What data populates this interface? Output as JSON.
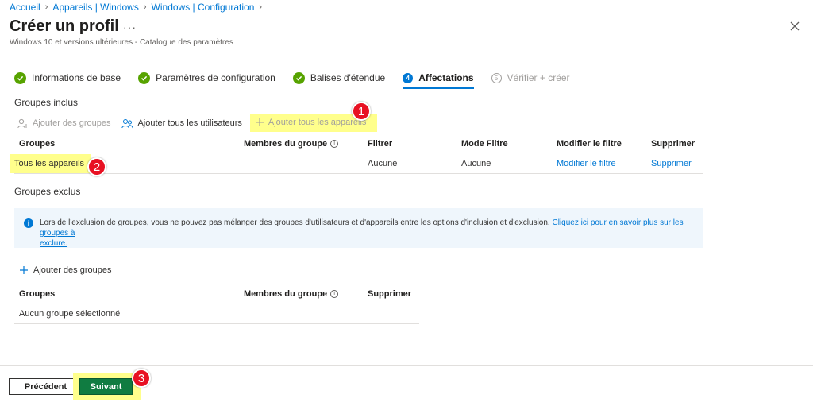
{
  "breadcrumb": [
    "Accueil",
    "Appareils | Windows",
    "Windows | Configuration"
  ],
  "header": {
    "title": "Créer un profil",
    "more": "···",
    "subtitle": "Windows 10 et versions ultérieures - Catalogue des paramètres"
  },
  "steps": [
    {
      "label": "Informations de base",
      "state": "done"
    },
    {
      "label": "Paramètres de configuration",
      "state": "done"
    },
    {
      "label": "Balises d'étendue",
      "state": "done"
    },
    {
      "label": "Affectations",
      "state": "active",
      "number": "4"
    },
    {
      "label": "Vérifier + créer",
      "state": "disabled",
      "number": "5"
    }
  ],
  "included": {
    "title": "Groupes inclus",
    "toolbar": {
      "add_groups": "Ajouter des groupes",
      "add_all_users": "Ajouter tous les utilisateurs",
      "add_all_devices": "Ajouter tous les appareils"
    },
    "columns": {
      "groups": "Groupes",
      "members": "Membres du groupe",
      "filter": "Filtrer",
      "filter_mode": "Mode Filtre",
      "edit_filter": "Modifier le filtre",
      "delete": "Supprimer"
    },
    "rows": [
      {
        "group": "Tous les appareils",
        "members": "",
        "filter": "Aucune",
        "filter_mode": "Aucune",
        "edit_filter": "Modifier le filtre",
        "delete": "Supprimer"
      }
    ]
  },
  "excluded": {
    "title": "Groupes exclus",
    "info_text": "Lors de l'exclusion de groupes, vous ne pouvez pas mélanger des groupes d'utilisateurs et d'appareils entre les options d'inclusion et d'exclusion. ",
    "info_link_part1": "Cliquez ici pour en savoir plus sur les groupes à",
    "info_link_part2": "exclure.",
    "add_groups": "Ajouter des groupes",
    "columns": {
      "groups": "Groupes",
      "members": "Membres du groupe",
      "delete": "Supprimer"
    },
    "empty": "Aucun groupe sélectionné"
  },
  "footer": {
    "previous": "Précédent",
    "next": "Suivant"
  },
  "annotations": [
    "1",
    "2",
    "3"
  ],
  "colors": {
    "accent": "#0078d4",
    "success": "#57a300",
    "highlight": "#ffff8c",
    "badge": "#e81123",
    "next_button": "#107c41"
  }
}
